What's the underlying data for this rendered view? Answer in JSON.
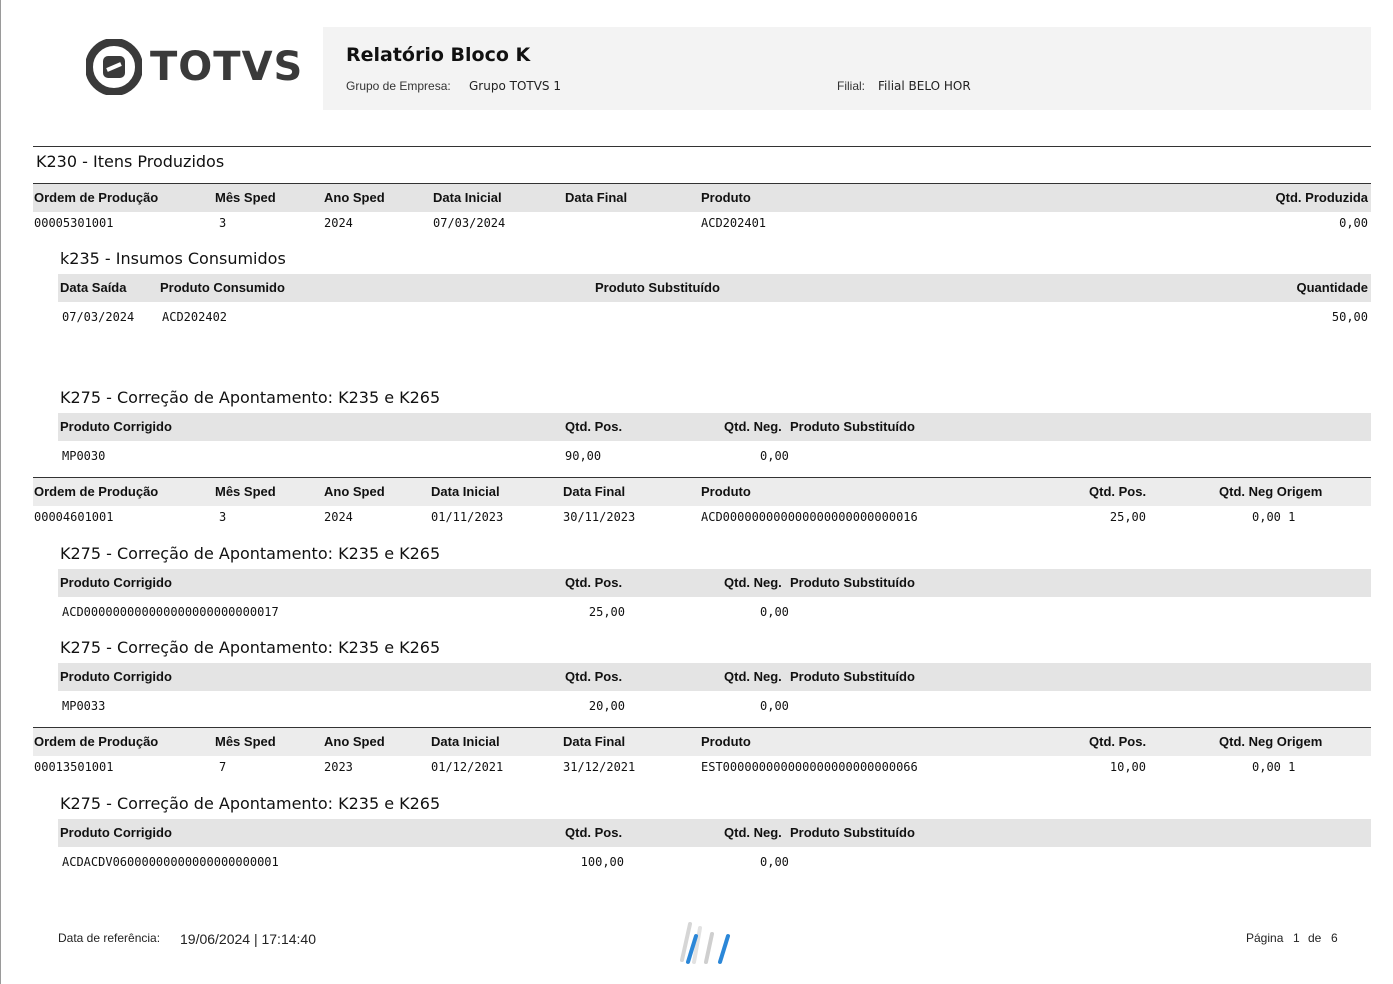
{
  "logo": {
    "text": "TOTVS"
  },
  "header": {
    "title": "Relatório Bloco K",
    "group_label": "Grupo de Empresa:",
    "group_value": "Grupo TOTVS 1",
    "branch_label": "Filial:",
    "branch_value": "Filial BELO HOR"
  },
  "k230": {
    "title": "K230 - Itens Produzidos",
    "columns": [
      "Ordem de Produção",
      "Mês  Sped",
      "Ano Sped",
      "Data Inicial",
      "Data Final",
      "Produto",
      "Qtd. Produzida"
    ],
    "row": [
      "00005301001",
      "3",
      "2024",
      "07/03/2024",
      "",
      "ACD202401",
      "0,00"
    ]
  },
  "k235": {
    "title": "k235 - Insumos Consumidos",
    "columns": [
      "Data Saída",
      "Produto Consumido",
      "Produto Substituído",
      "Quantidade"
    ],
    "row": [
      "07/03/2024",
      "ACD202402",
      "",
      "50,00"
    ]
  },
  "k275_columns": [
    "Produto Corrigido",
    "Qtd. Pos.",
    "Qtd. Neg.",
    "Produto Substituído"
  ],
  "k275_title": "K275 - Correção de Apontamento: K235 e K265",
  "k275_a": {
    "row": [
      "MP0030",
      "90,00",
      "0,00"
    ]
  },
  "order_columns": [
    "Ordem de Produção",
    "Mês Sped",
    "Ano Sped",
    "Data Inicial",
    "Data Final",
    "Produto",
    "Qtd. Pos.",
    "Qtd. Neg Origem"
  ],
  "order_2": {
    "row": [
      "00004601001",
      "3",
      "2024",
      "01/11/2023",
      "30/11/2023",
      "ACD000000000000000000000000016",
      "25,00",
      "0,00 1"
    ]
  },
  "k275_b": {
    "row": [
      "ACD000000000000000000000000017",
      "25,00",
      "0,00"
    ]
  },
  "k275_c": {
    "row": [
      "MP0033",
      "20,00",
      "0,00"
    ]
  },
  "order_3": {
    "row": [
      "00013501001",
      "7",
      "2023",
      "01/12/2021",
      "31/12/2021",
      "EST000000000000000000000000066",
      "10,00",
      "0,00 1"
    ]
  },
  "k275_d": {
    "row": [
      "ACDACDV06000000000000000000001",
      "100,00",
      "0,00"
    ]
  },
  "footer": {
    "ref_label": "Data de referência:",
    "ref_value": "19/06/2024 | 17:14:40",
    "page_label": "Página",
    "page_num": "1",
    "page_of": "de",
    "page_total": "6"
  }
}
